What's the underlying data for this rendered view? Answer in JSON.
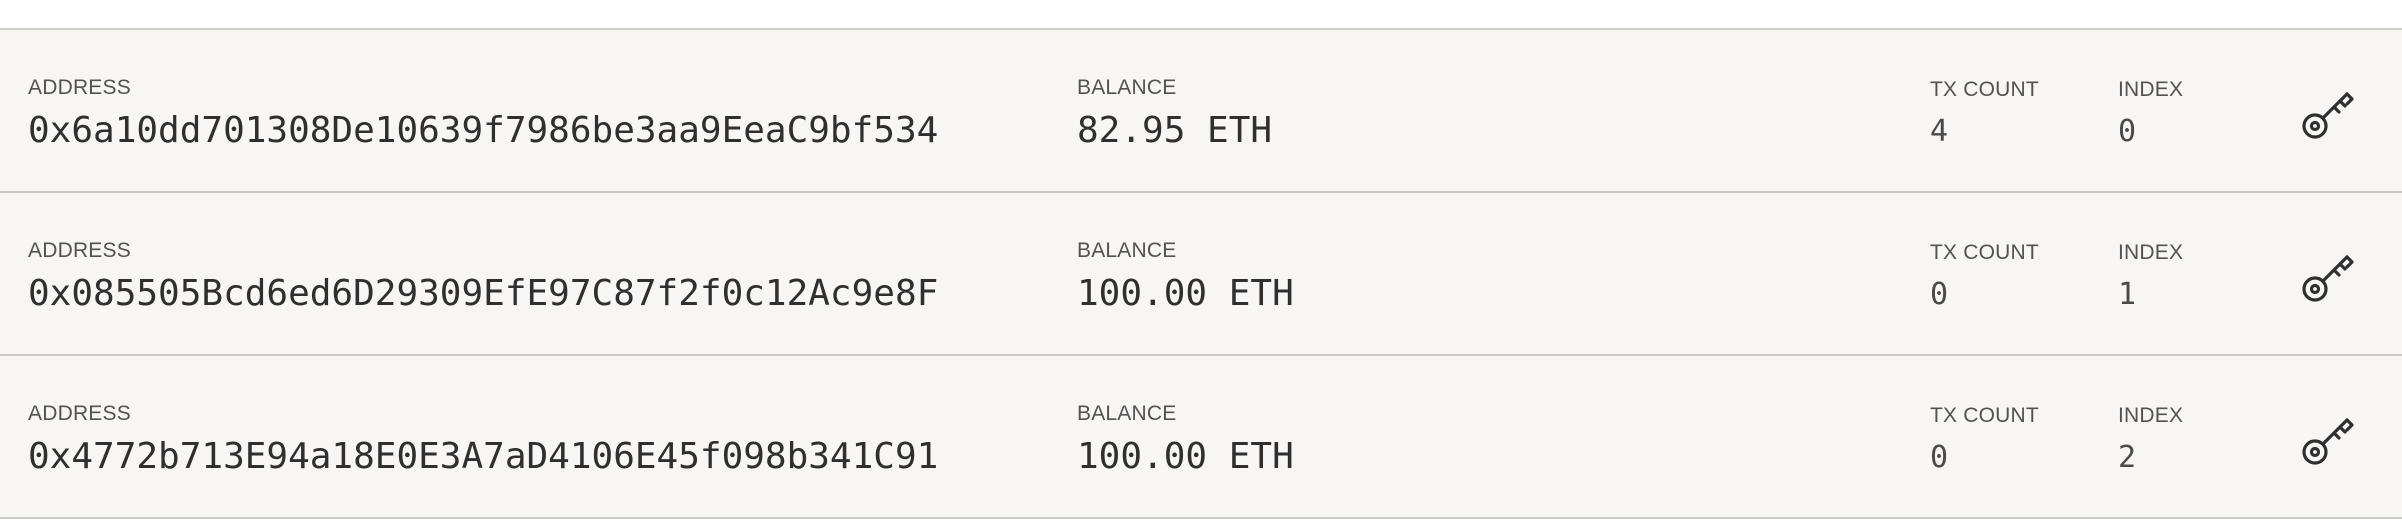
{
  "labels": {
    "address": "ADDRESS",
    "balance": "BALANCE",
    "tx_count": "TX COUNT",
    "index": "INDEX"
  },
  "accounts": [
    {
      "address": "0x6a10dd701308De10639f7986be3aa9EeaC9bf534",
      "balance": "82.95 ETH",
      "tx_count": "4",
      "index": "0",
      "key_icon": "key-icon"
    },
    {
      "address": "0x085505Bcd6ed6D29309EfE97C87f2f0c12Ac9e8F",
      "balance": "100.00 ETH",
      "tx_count": "0",
      "index": "1",
      "key_icon": "key-icon"
    },
    {
      "address": "0x4772b713E94a18E0E3A7aD4106E45f098b341C91",
      "balance": "100.00 ETH",
      "tx_count": "0",
      "index": "2",
      "key_icon": "key-icon"
    }
  ],
  "colors": {
    "row_background": "#f7f6f4",
    "divider": "#c9c8c5",
    "label_text": "#525252",
    "value_text": "#2f2f2f"
  }
}
